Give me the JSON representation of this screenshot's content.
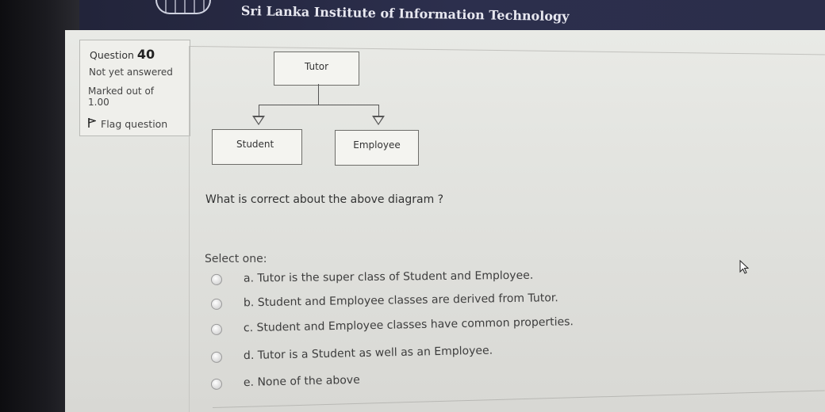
{
  "header": {
    "title": "Sri Lanka Institute of Information Technology",
    "logo_icon": "university-logo-icon"
  },
  "info": {
    "question_label": "Question",
    "question_number": "40",
    "status": "Not yet answered",
    "marked_out_of_label": "Marked out of",
    "marked_out_of_value": "1.00",
    "flag_label": "Flag question",
    "flag_icon": "flag-icon"
  },
  "diagram": {
    "parent": "Tutor",
    "children": [
      "Student",
      "Employee"
    ]
  },
  "question": {
    "text": "What is correct about the above diagram ?",
    "select_label": "Select one:",
    "options": [
      {
        "label": "a. Tutor is the super class of Student and Employee."
      },
      {
        "label": "b. Student and Employee classes are derived from Tutor."
      },
      {
        "label": "c. Student and Employee classes have common properties."
      },
      {
        "label": "d. Tutor is a Student as well as an Employee."
      },
      {
        "label": "e. None of the above"
      }
    ]
  },
  "cursor_icon": "mouse-pointer-icon"
}
